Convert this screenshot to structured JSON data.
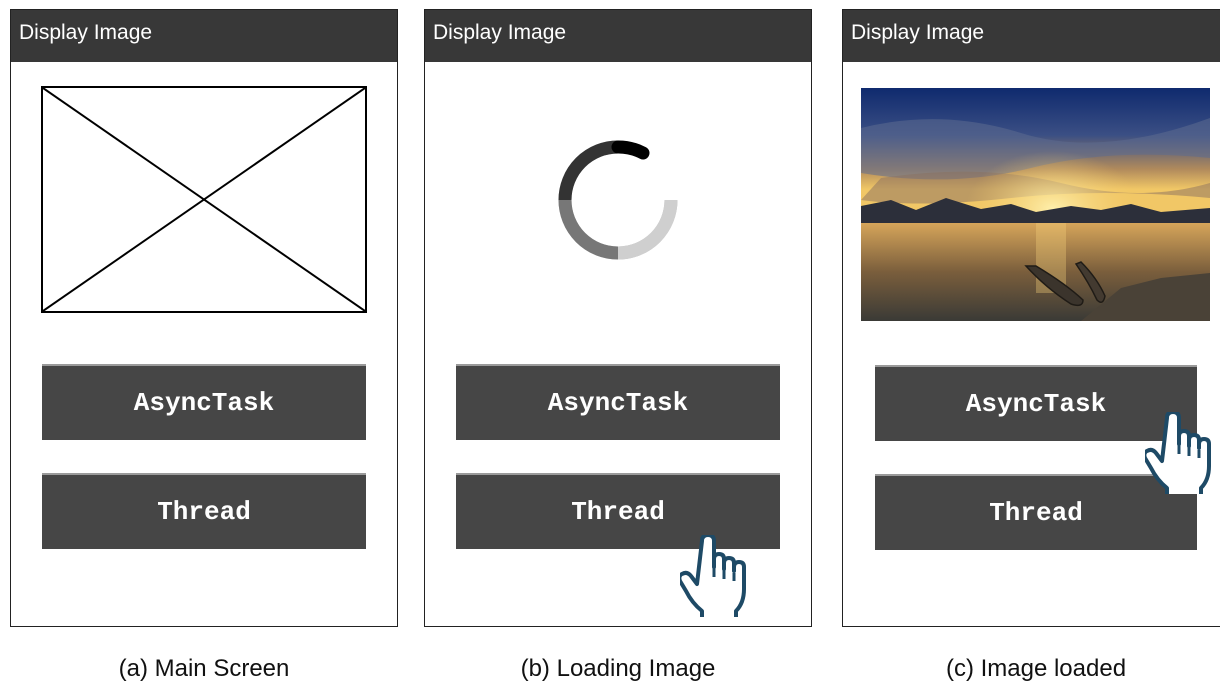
{
  "screens": [
    {
      "app_title": "Display Image",
      "state": "empty-placeholder",
      "buttons": {
        "async_label": "AsyncTask",
        "thread_label": "Thread"
      },
      "caption": "(a) Main Screen"
    },
    {
      "app_title": "Display Image",
      "state": "loading",
      "buttons": {
        "async_label": "AsyncTask",
        "thread_label": "Thread"
      },
      "tapped_button": "Thread",
      "caption": "(b) Loading Image"
    },
    {
      "app_title": "Display Image",
      "state": "image-loaded",
      "buttons": {
        "async_label": "AsyncTask",
        "thread_label": "Thread"
      },
      "tapped_button": "AsyncTask",
      "caption": "(c) Image loaded"
    }
  ],
  "colors": {
    "appbar": "#383838",
    "button": "#464646",
    "cursor_stroke": "#1e4a66"
  },
  "icons": {
    "placeholder": "image-placeholder-icon",
    "loading": "loading-spinner-icon",
    "pointer": "hand-pointer-icon"
  }
}
